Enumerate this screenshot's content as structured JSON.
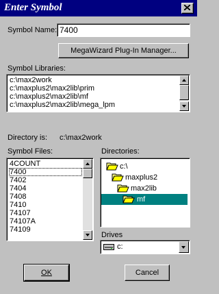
{
  "window": {
    "title": "Enter Symbol"
  },
  "symbol_name": {
    "label": "Symbol Name:",
    "value": "7400"
  },
  "megawizard_button": {
    "label": "MegaWizard Plug-In Manager..."
  },
  "symbol_libraries": {
    "label": "Symbol Libraries:",
    "items": [
      "c:\\max2work",
      "c:\\maxplus2\\max2lib\\prim",
      "c:\\maxplus2\\max2lib\\mf",
      "c:\\maxplus2\\max2lib\\mega_lpm"
    ]
  },
  "directory": {
    "label": "Directory is:",
    "value": "c:\\max2work"
  },
  "symbol_files": {
    "label": "Symbol Files:",
    "selected": "7400",
    "items": [
      "4COUNT",
      "7400",
      "7402",
      "7404",
      "7408",
      "7410",
      "74107",
      "74107A",
      "74109"
    ]
  },
  "directories": {
    "label": "Directories:",
    "items": [
      "c:\\",
      "maxplus2",
      "max2lib",
      "mf"
    ],
    "selected": "mf"
  },
  "drives": {
    "label": "Drives",
    "value": "c:"
  },
  "ok_button": {
    "label": "OK"
  },
  "cancel_button": {
    "label": "Cancel"
  },
  "colors": {
    "titlebar": "#000080",
    "selection": "#008080",
    "face": "#c0c0c0"
  }
}
